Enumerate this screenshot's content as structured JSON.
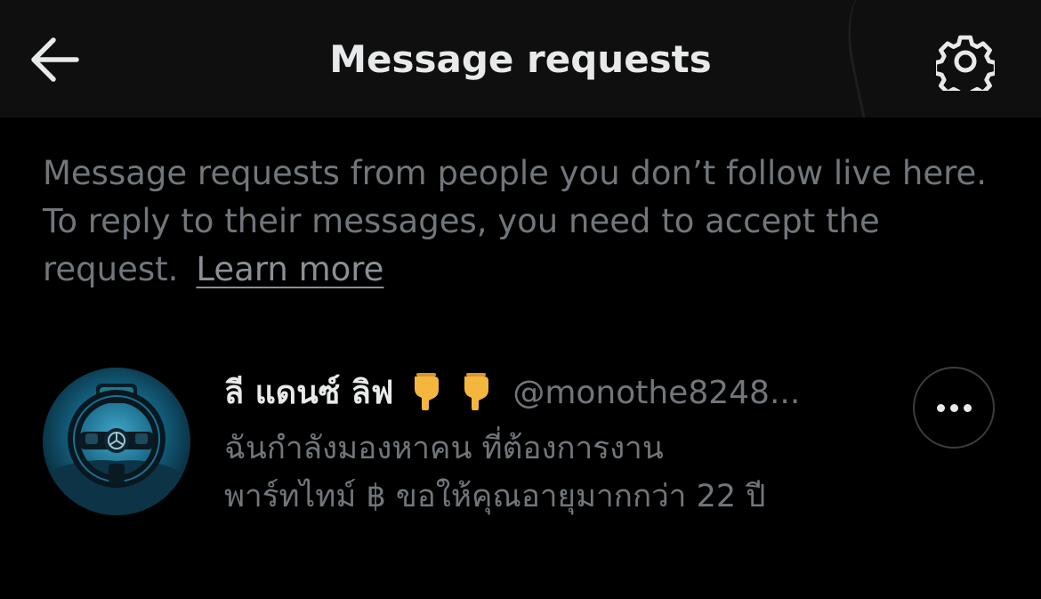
{
  "header": {
    "title": "Message requests",
    "back_icon": "arrow-left-icon",
    "settings_icon": "gear-icon"
  },
  "info": {
    "text": "Message requests from people you don’t follow live here. To reply to their messages, you need to accept the request.",
    "learn_more": "Learn more"
  },
  "requests": [
    {
      "name": "ลี แดนซ์ ลิฟ",
      "emojis": [
        "pointing-down-hand-icon",
        "pointing-down-hand-icon"
      ],
      "handle": "@monothe8248...",
      "preview_line1": "ฉันกำลังมองหาคน ที่ต้องการงาน",
      "preview_line2": "พาร์ทไทม์ ฿ ขอให้คุณอายุมากกว่า 22 ปี",
      "more_icon": "more-options-icon"
    }
  ],
  "colors": {
    "background": "#000000",
    "header_background": "#0f0f0f",
    "primary_text": "#e7e9ea",
    "secondary_text": "#71767b",
    "emoji_yellow": "#f4b73e"
  }
}
